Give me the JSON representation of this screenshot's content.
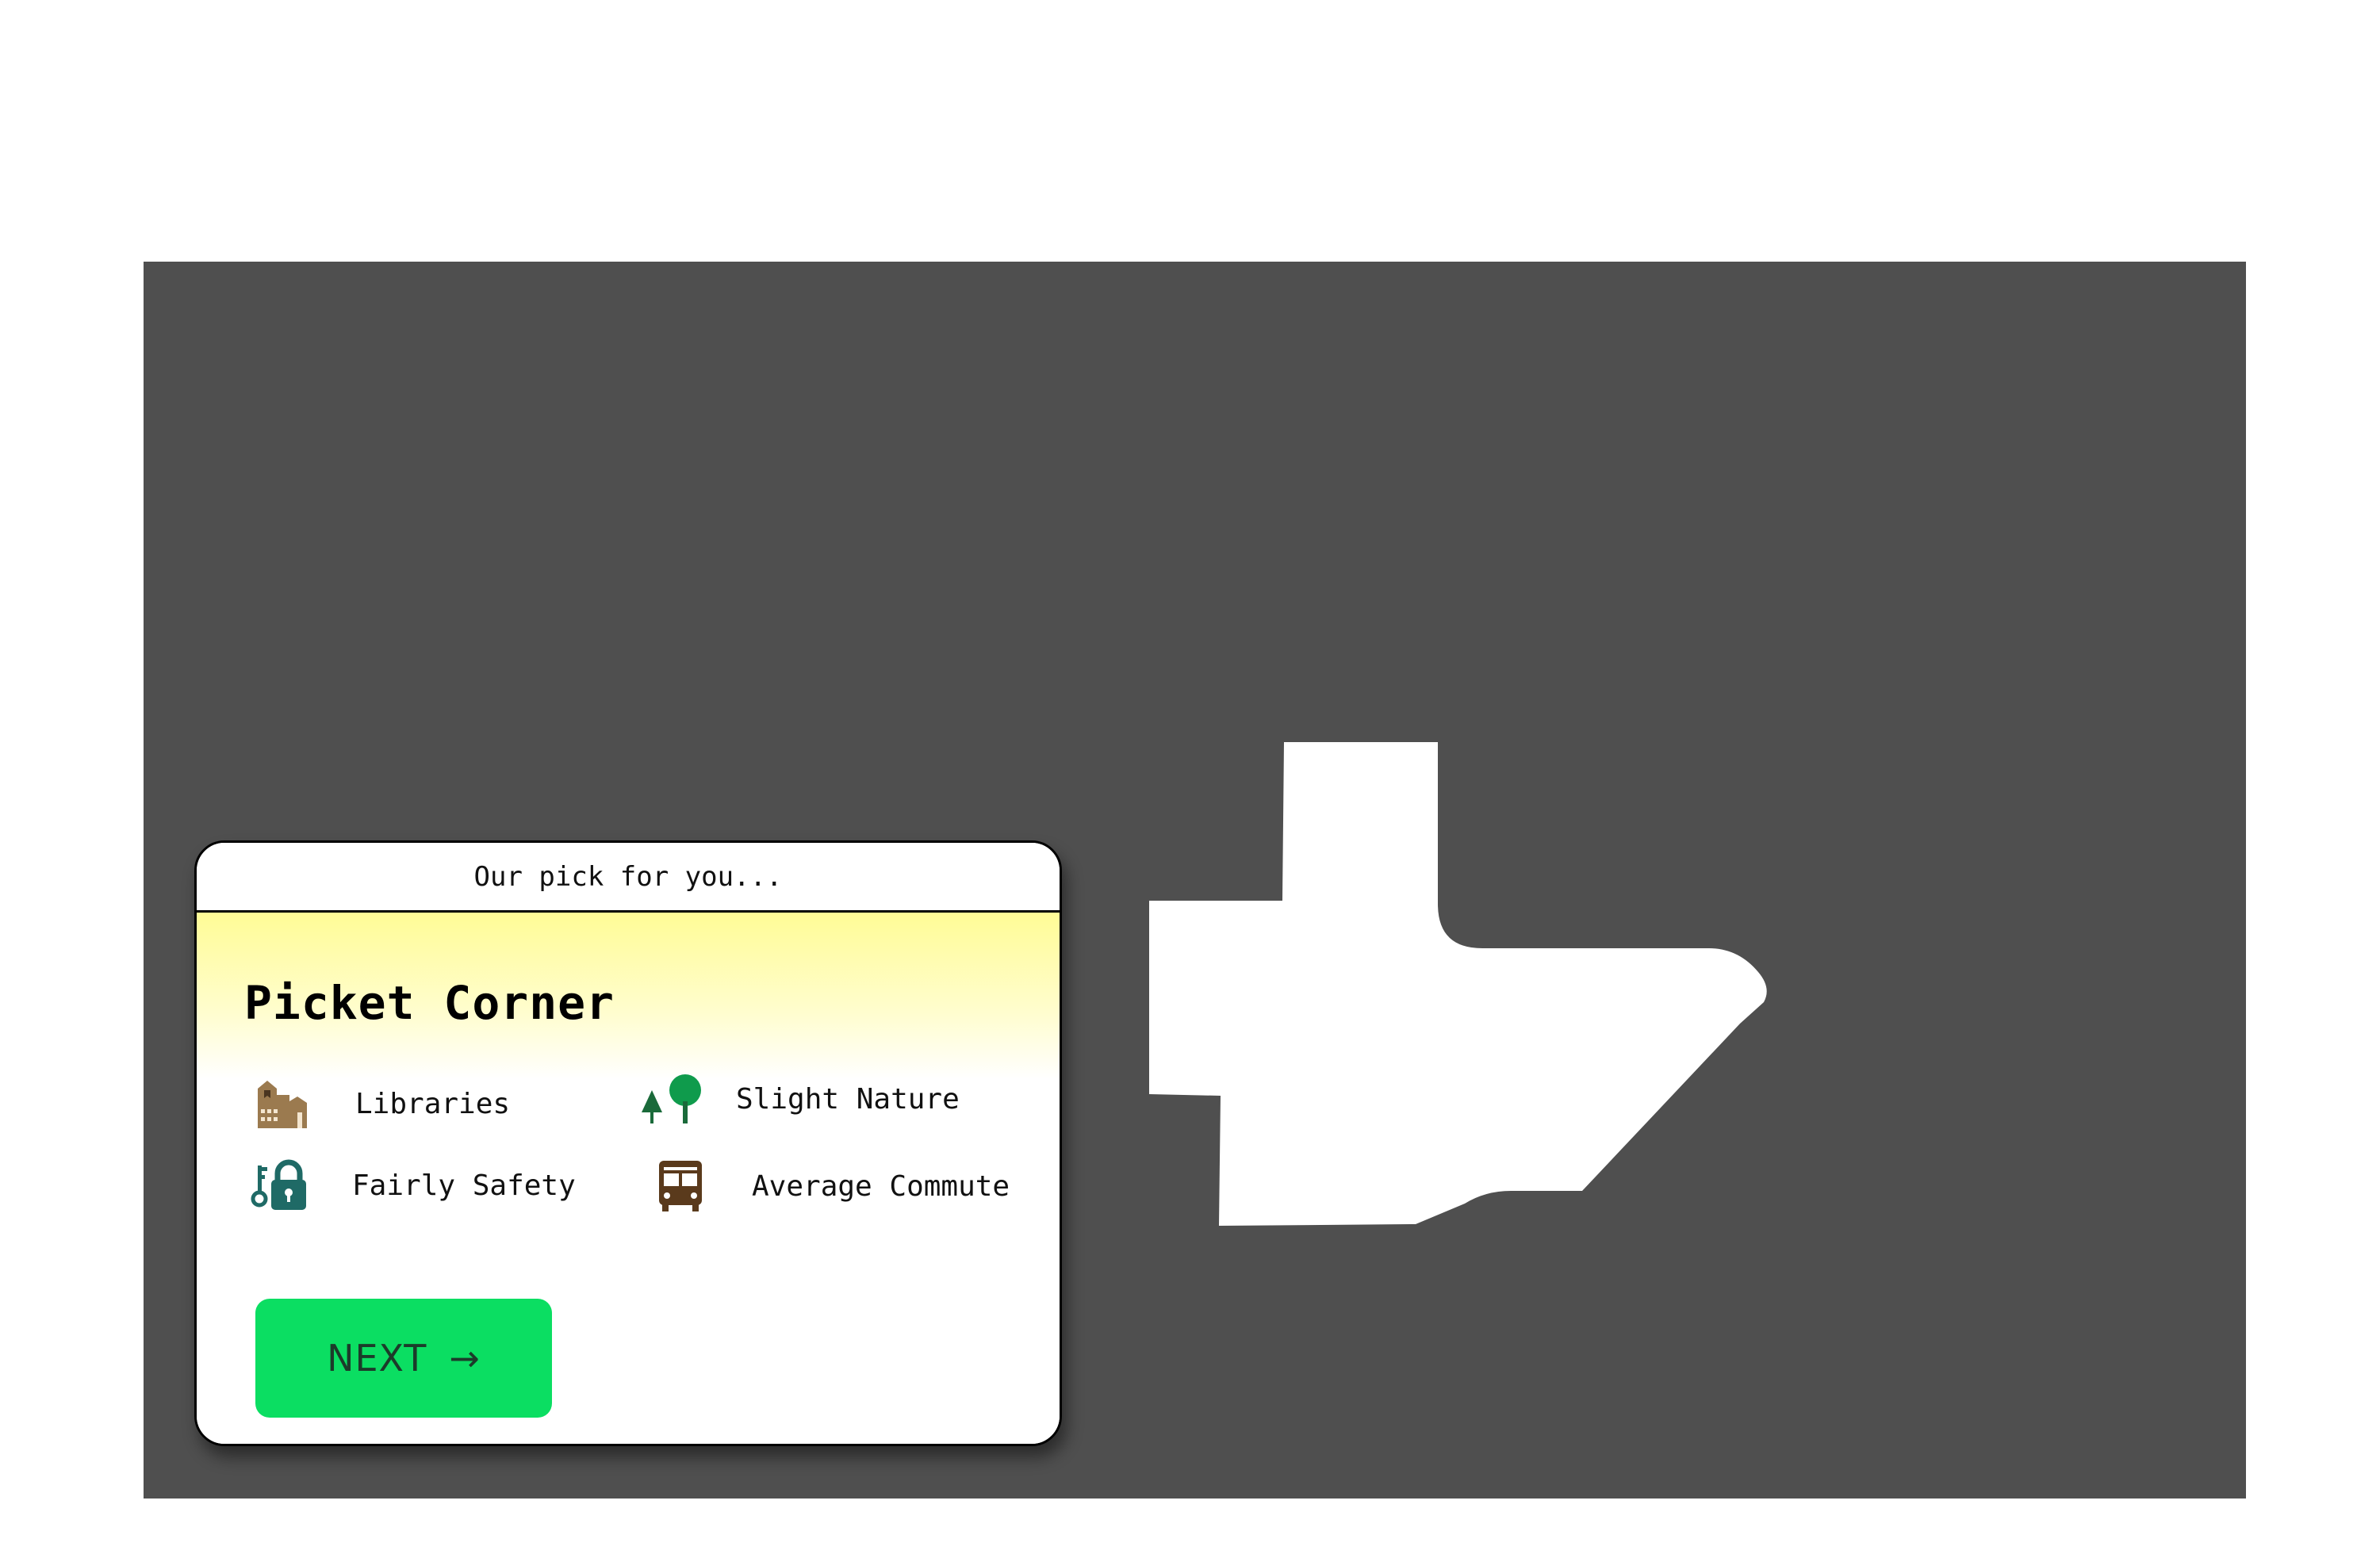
{
  "card": {
    "header": "Our pick for you...",
    "title": "Picket Corner",
    "features": [
      {
        "icon": "library-building-icon",
        "label": "Libraries"
      },
      {
        "icon": "trees-icon",
        "label": "Slight Nature"
      },
      {
        "icon": "key-lock-icon",
        "label": "Fairly Safety"
      },
      {
        "icon": "bus-icon",
        "label": "Average Commute"
      }
    ],
    "next_label": "NEXT",
    "next_arrow": "→"
  },
  "colors": {
    "map_background": "#4f4f4f",
    "region": "#ffffff",
    "button": "#0bde62",
    "library_icon": "#9b7a4f",
    "trees_icon": "#1a8a4a",
    "lock_icon": "#1f6a66",
    "bus_icon": "#5a3a1c"
  }
}
